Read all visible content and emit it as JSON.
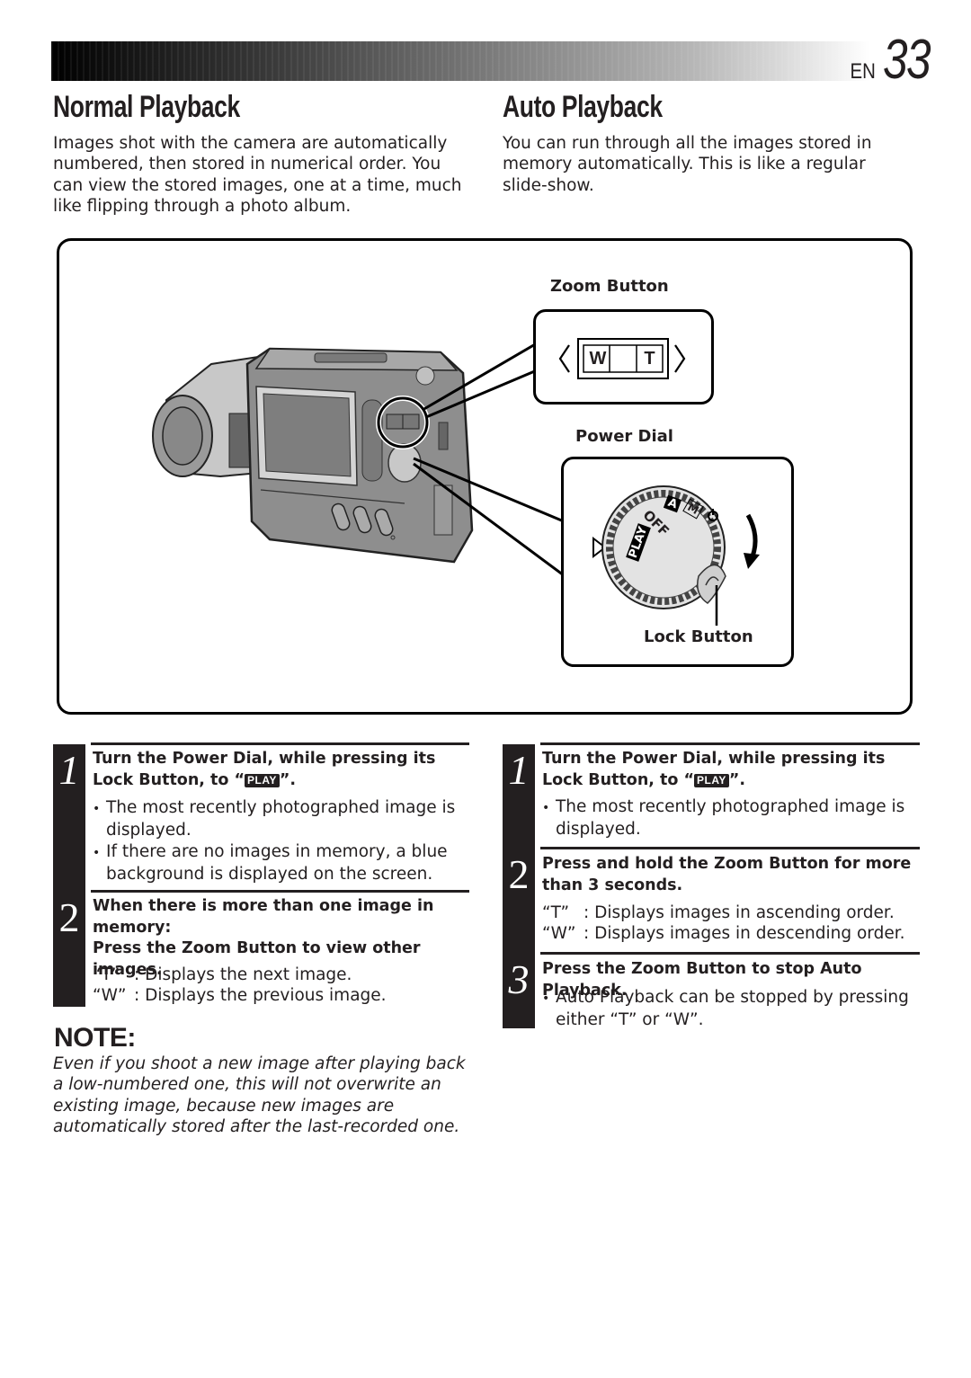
{
  "header": {
    "lang": "EN",
    "page_number": "33"
  },
  "normal": {
    "title": "Normal Playback",
    "intro": "Images shot with the camera are automatically numbered, then stored in numerical order. You can view the stored images, one at a time, much like flipping through a photo album.",
    "steps": [
      {
        "number": "1",
        "heading_pre": "Turn the Power Dial, while pressing its Lock Button, to “",
        "heading_badge": "PLAY",
        "heading_post": "”.",
        "bullets": [
          "The most recently photographed image is displayed.",
          "If there are no images in memory, a blue background is displayed on the screen."
        ]
      },
      {
        "number": "2",
        "heading_line1": "When there is more than one image in memory:",
        "heading_line2": "Press the Zoom Button to view other images.",
        "items": [
          {
            "key": "“T”",
            "value": ": Displays the next image."
          },
          {
            "key": "“W”",
            "value": ": Displays the previous image."
          }
        ]
      }
    ]
  },
  "auto": {
    "title": "Auto Playback",
    "intro": "You can run through all the images stored in memory automatically. This is like a regular slide-show.",
    "steps": [
      {
        "number": "1",
        "heading_pre": "Turn the Power Dial, while pressing its Lock Button, to “",
        "heading_badge": "PLAY",
        "heading_post": "”.",
        "bullets": [
          "The most recently photographed image is displayed."
        ]
      },
      {
        "number": "2",
        "heading": "Press and hold the Zoom Button for more than 3 seconds.",
        "items": [
          {
            "key": "“T”",
            "value": ": Displays images in ascending order."
          },
          {
            "key": "“W”",
            "value": ": Displays images in descending order."
          }
        ]
      },
      {
        "number": "3",
        "heading": "Press the Zoom Button to stop Auto Playback.",
        "bullets": [
          "Auto Playback can be stopped by pressing either “T” or “W”."
        ]
      }
    ]
  },
  "figure": {
    "zoom_label": "Zoom Button",
    "zoom_w": "W",
    "zoom_t": "T",
    "power_label": "Power Dial",
    "lock_label": "Lock Button",
    "dial_modes": [
      "PLAY",
      "OFF",
      "A",
      "M"
    ]
  },
  "note": {
    "title": "NOTE:",
    "text": "Even if you shoot a new image after playing back a low-numbered one, this will not overwrite an existing image, because new images are automatically stored after the last-recorded one."
  }
}
